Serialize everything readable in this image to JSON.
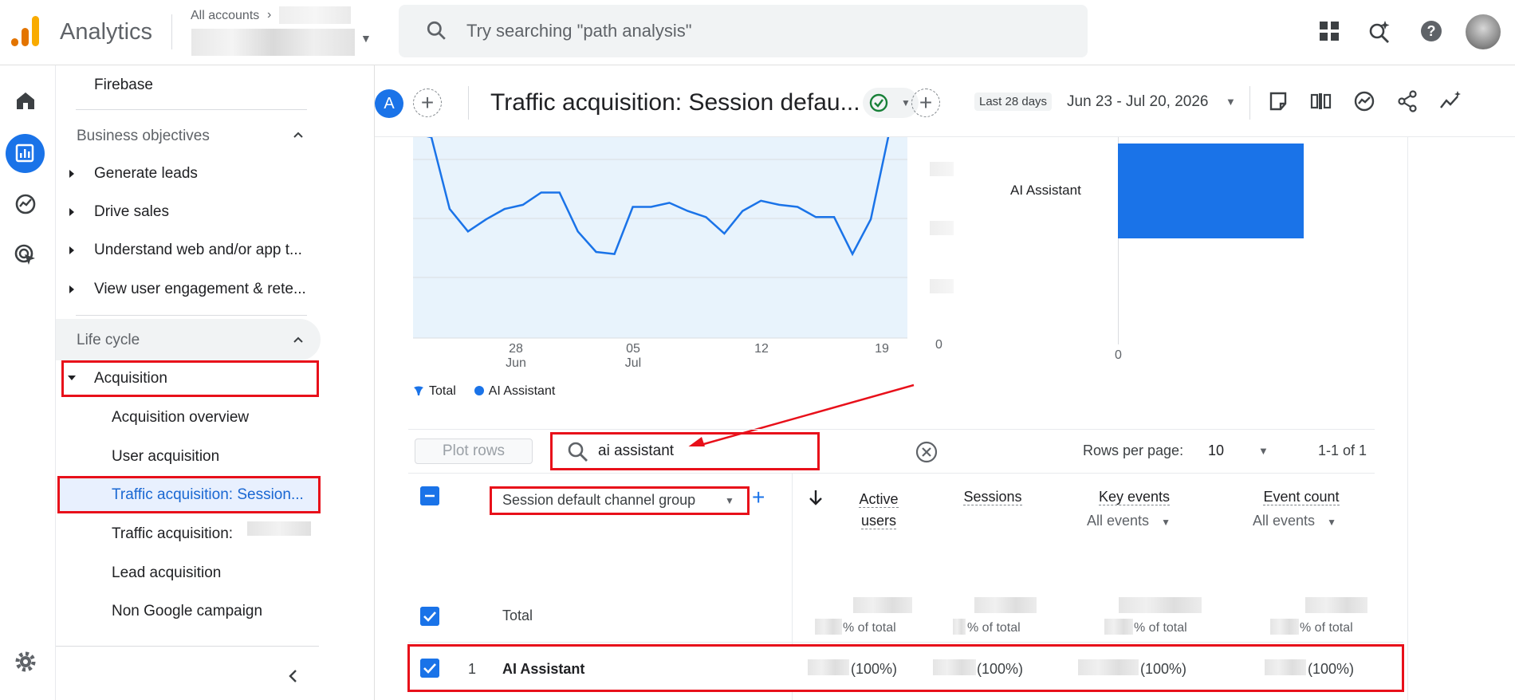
{
  "app": {
    "name": "Analytics",
    "account_label": "All accounts",
    "search_placeholder": "Try searching \"path analysis\""
  },
  "nav": {
    "firebase": "Firebase",
    "business_objectives": "Business objectives",
    "generate_leads": "Generate leads",
    "drive_sales": "Drive sales",
    "understand_web": "Understand web and/or app t...",
    "view_engagement": "View user engagement & rete...",
    "life_cycle": "Life cycle",
    "acquisition": "Acquisition",
    "acquisition_overview": "Acquisition overview",
    "user_acquisition": "User acquisition",
    "traffic_acq_session": "Traffic acquisition: Session...",
    "traffic_acq_other": "Traffic acquisition: ",
    "lead_acquisition": "Lead acquisition",
    "non_google_campaign": "Non Google campaign"
  },
  "report": {
    "segment_letter": "A",
    "title": "Traffic acquisition: Session defau...",
    "date_chip": "Last 28 days",
    "date_range": "Jun 23 - Jul 20, 2026"
  },
  "chart_data": [
    {
      "type": "area",
      "x_tick_labels": [
        "28\nJun",
        "05\nJul",
        "12",
        "19"
      ],
      "y_min_label": "0",
      "legend": [
        "Total",
        "AI Assistant"
      ],
      "series": [
        {
          "name": "AI Assistant",
          "x": [
            "Jun 23",
            "Jun 24",
            "Jun 25",
            "Jun 26",
            "Jun 27",
            "Jun 28",
            "Jun 29",
            "Jun 30",
            "Jul 1",
            "Jul 2",
            "Jul 3",
            "Jul 4",
            "Jul 5",
            "Jul 6",
            "Jul 7",
            "Jul 8",
            "Jul 9",
            "Jul 10",
            "Jul 11",
            "Jul 12",
            "Jul 13",
            "Jul 14",
            "Jul 15",
            "Jul 16",
            "Jul 17",
            "Jul 18",
            "Jul 19",
            "Jul 20"
          ],
          "values": [
            100,
            98,
            63,
            52,
            58,
            63,
            65,
            71,
            71,
            52,
            42,
            41,
            64,
            64,
            66,
            62,
            59,
            51,
            62,
            67,
            65,
            64,
            59,
            59,
            41,
            58,
            100,
            100
          ]
        }
      ]
    },
    {
      "type": "bar",
      "orientation": "horizontal",
      "categories": [
        "AI Assistant"
      ],
      "values": [
        1
      ],
      "x_min_label": "0"
    }
  ],
  "table": {
    "plot_rows": "Plot rows",
    "search_value": "ai assistant",
    "rows_per_page_label": "Rows per page:",
    "rows_per_page": "10",
    "pager": "1-1 of 1",
    "dimension": "Session default channel group",
    "metrics": {
      "active_users_1": "Active",
      "active_users_2": "users",
      "sessions": "Sessions",
      "key_events": "Key events",
      "key_events_sub": "All events",
      "event_count": "Event count",
      "event_count_sub": "All events"
    },
    "total_label": "Total",
    "pct_of_total": "% of total",
    "row": {
      "index": "1",
      "name": "AI Assistant",
      "pct": "(100%)"
    }
  }
}
